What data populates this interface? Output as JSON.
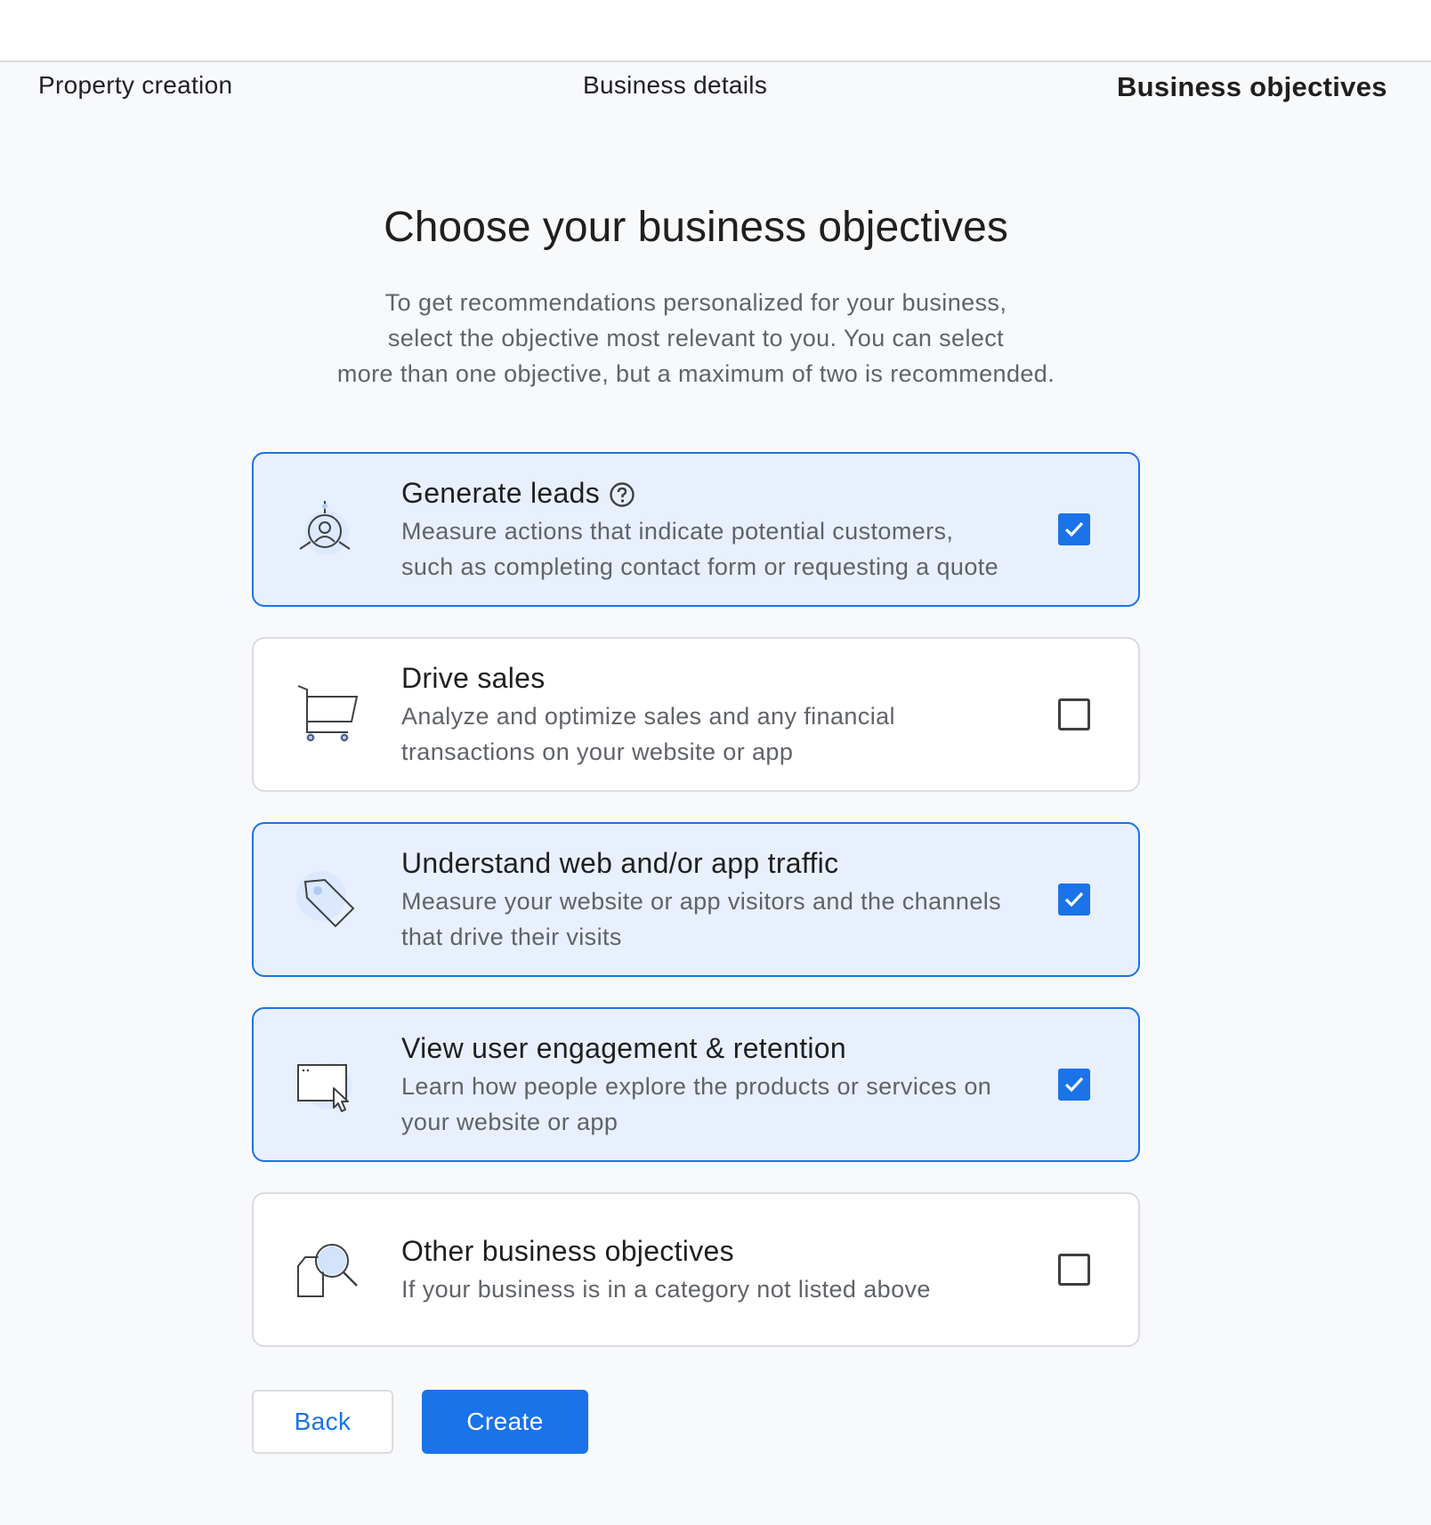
{
  "steps": [
    "Property creation",
    "Business details",
    "Business objectives"
  ],
  "heading": {
    "title": "Choose your business objectives",
    "subtitle_lines": [
      "To get recommendations personalized for your business,",
      "select the objective most relevant to you. You can select",
      "more than one objective, but a maximum of two is recommended."
    ]
  },
  "objectives": [
    {
      "title": "Generate leads",
      "has_help": true,
      "help_icon": "help-circle-icon",
      "icon": "leads-target-person-icon",
      "desc_lines": [
        "Measure actions that indicate potential customers,",
        "such as completing contact form or requesting a quote"
      ],
      "checked": true
    },
    {
      "title": "Drive sales",
      "has_help": false,
      "icon": "shopping-cart-icon",
      "desc_lines": [
        "Analyze and optimize sales and any financial",
        "transactions on your website or app"
      ],
      "checked": false
    },
    {
      "title": "Understand web and/or app traffic",
      "has_help": false,
      "icon": "price-tag-icon",
      "desc_lines": [
        "Measure your website or app visitors and the channels",
        "that drive their visits"
      ],
      "checked": true
    },
    {
      "title": "View user engagement & retention",
      "has_help": false,
      "icon": "browser-cursor-icon",
      "desc_lines": [
        "Learn how people explore the products or services on",
        "your website or app"
      ],
      "checked": true
    },
    {
      "title": "Other business objectives",
      "has_help": false,
      "icon": "magnifier-document-icon",
      "desc_lines": [
        "If your business is in a category not listed above"
      ],
      "checked": false
    }
  ],
  "buttons": {
    "back": "Back",
    "create": "Create"
  },
  "colors": {
    "accent": "#1a73e8",
    "selected_bg": "#e8f0fe",
    "icon_tint": "#d2e3fc"
  }
}
